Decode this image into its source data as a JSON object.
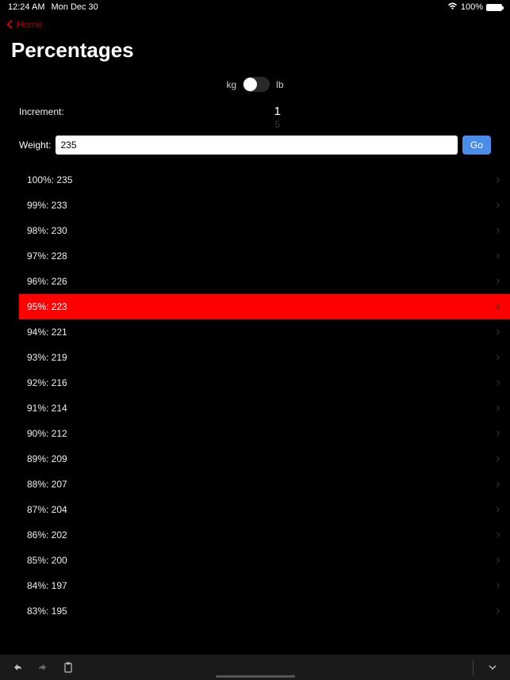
{
  "status": {
    "time": "12:24 AM",
    "date": "Mon Dec 30",
    "battery": "100%"
  },
  "nav": {
    "back_label": "Home"
  },
  "title": "Percentages",
  "unit": {
    "left": "kg",
    "right": "lb"
  },
  "increment": {
    "label": "Increment:",
    "value": "1",
    "next": "5"
  },
  "weight": {
    "label": "Weight:",
    "value": "235",
    "go_label": "Go"
  },
  "rows": [
    {
      "pct": "100%",
      "val": "235",
      "selected": false
    },
    {
      "pct": "99%",
      "val": "233",
      "selected": false
    },
    {
      "pct": "98%",
      "val": "230",
      "selected": false
    },
    {
      "pct": "97%",
      "val": "228",
      "selected": false
    },
    {
      "pct": "96%",
      "val": "226",
      "selected": false
    },
    {
      "pct": "95%",
      "val": "223",
      "selected": true
    },
    {
      "pct": "94%",
      "val": "221",
      "selected": false
    },
    {
      "pct": "93%",
      "val": "219",
      "selected": false
    },
    {
      "pct": "92%",
      "val": "216",
      "selected": false
    },
    {
      "pct": "91%",
      "val": "214",
      "selected": false
    },
    {
      "pct": "90%",
      "val": "212",
      "selected": false
    },
    {
      "pct": "89%",
      "val": "209",
      "selected": false
    },
    {
      "pct": "88%",
      "val": "207",
      "selected": false
    },
    {
      "pct": "87%",
      "val": "204",
      "selected": false
    },
    {
      "pct": "86%",
      "val": "202",
      "selected": false
    },
    {
      "pct": "85%",
      "val": "200",
      "selected": false
    },
    {
      "pct": "84%",
      "val": "197",
      "selected": false
    },
    {
      "pct": "83%",
      "val": "195",
      "selected": false
    }
  ]
}
